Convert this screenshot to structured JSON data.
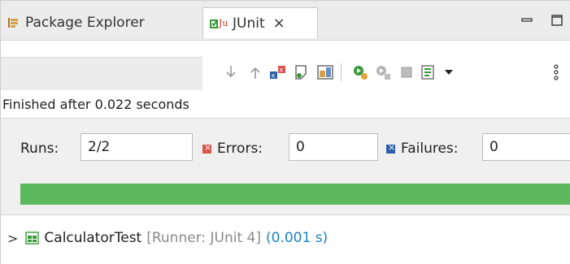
{
  "tabs": {
    "package_explorer": "Package Explorer",
    "junit": "JUnit",
    "close_glyph": "×"
  },
  "toolbar": {
    "icons": [
      "next-failure-icon",
      "previous-failure-icon",
      "show-failures-only-icon",
      "scroll-lock-icon",
      "layout-icon",
      "rerun-test-icon",
      "rerun-failed-first-icon",
      "stop-icon",
      "test-run-history-icon",
      "view-menu-icon",
      "more-icon"
    ]
  },
  "status": {
    "finished_text": "Finished after 0.022 seconds"
  },
  "counters": {
    "runs_label": "Runs:",
    "runs_value": "2/2",
    "errors_label": "Errors:",
    "errors_value": "0",
    "failures_label": "Failures:",
    "failures_value": "0"
  },
  "progress": {
    "fraction": 1.0,
    "color": "#5cb85c"
  },
  "tree": {
    "items": [
      {
        "name": "CalculatorTest",
        "runner": "[Runner: JUnit 4]",
        "time": "(0.001 s)"
      }
    ]
  },
  "colors": {
    "error_red": "#d9534f",
    "failure_blue": "#2b5ea7",
    "time_blue": "#1a82c8"
  }
}
